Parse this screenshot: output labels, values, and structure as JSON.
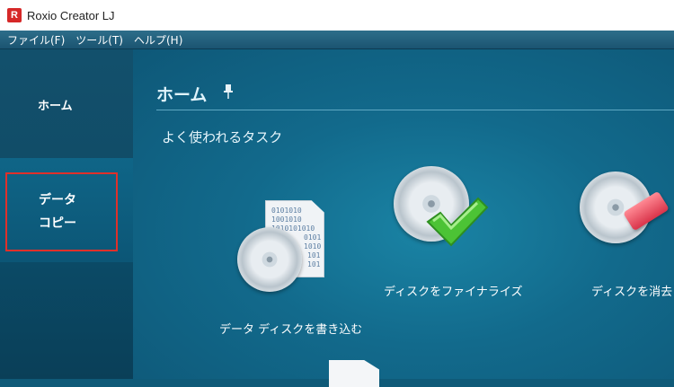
{
  "window": {
    "title": "Roxio Creator LJ",
    "app_icon": "roxio-r-icon",
    "app_icon_letter": "R"
  },
  "menubar": {
    "items": [
      "ファイル(F)",
      "ツール(T)",
      "ヘルプ(H)"
    ]
  },
  "sidebar": {
    "home_label": "ホーム",
    "data_label": "データ",
    "copy_label": "コピー"
  },
  "main": {
    "page_title": "ホーム",
    "pin_icon": "pin-icon",
    "section_title": "よく使われるタスク",
    "tasks": [
      {
        "label": "データ ディスクを書き込む",
        "icon": "disc-with-document-icon",
        "doc_lines": [
          "0101010",
          "1001010",
          "1010101010",
          "0101",
          "1010",
          "101",
          "101"
        ]
      },
      {
        "label": "ディスクをファイナライズ",
        "icon": "disc-with-checkmark-icon"
      },
      {
        "label": "ディスクを消去",
        "icon": "disc-with-eraser-icon"
      }
    ]
  },
  "colors": {
    "highlight_border": "#e0302a",
    "accent_blue": "#126a8c"
  }
}
